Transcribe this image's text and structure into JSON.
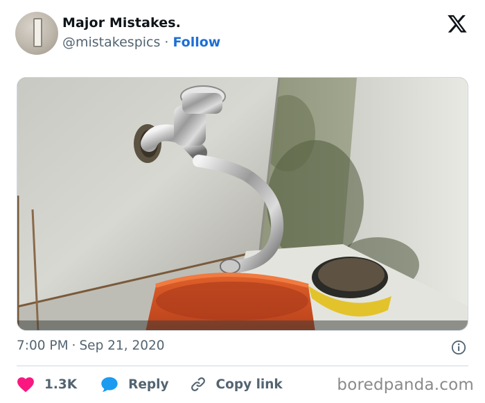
{
  "tweet": {
    "author_name": "Major Mistakes.",
    "author_handle": "@mistakespics",
    "separator": "·",
    "follow_label": "Follow",
    "platform_logo_icon": "x-logo-icon",
    "photo_alt_icon": "photo",
    "time": "7:00 PM",
    "date": "Sep 21, 2020",
    "info_icon": "info-icon"
  },
  "actions": {
    "like_count": "1.3K",
    "like_icon": "heart-icon",
    "reply_label": "Reply",
    "reply_icon": "speech-bubble-icon",
    "copy_label": "Copy link",
    "copy_icon": "link-icon"
  },
  "watermark": "boredpanda.com",
  "colors": {
    "like": "#f91880",
    "reply": "#1d9bf0",
    "follow": "#1d6fd6",
    "secondary_text": "#536471"
  }
}
